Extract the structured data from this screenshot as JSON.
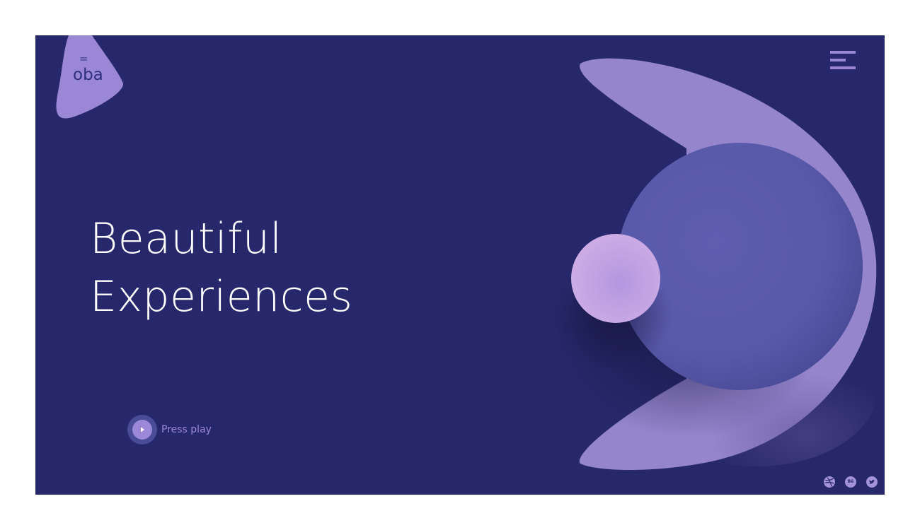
{
  "logo": {
    "mark": "=",
    "text": "oba"
  },
  "hero": {
    "title_line_1": "Beautiful",
    "title_line_2": "Experiences"
  },
  "play": {
    "label": "Press play"
  },
  "menu": {
    "icon": "hamburger-menu-icon"
  },
  "social": {
    "items": [
      {
        "icon": "dribbble-icon"
      },
      {
        "icon": "behance-icon",
        "text": "Bē"
      },
      {
        "icon": "twitter-icon"
      }
    ]
  },
  "colors": {
    "background": "#27286b",
    "accent": "#9a87d6",
    "large_circle": "#5a5aab",
    "small_circle": "#c6a3df",
    "text": "#ffffff"
  }
}
